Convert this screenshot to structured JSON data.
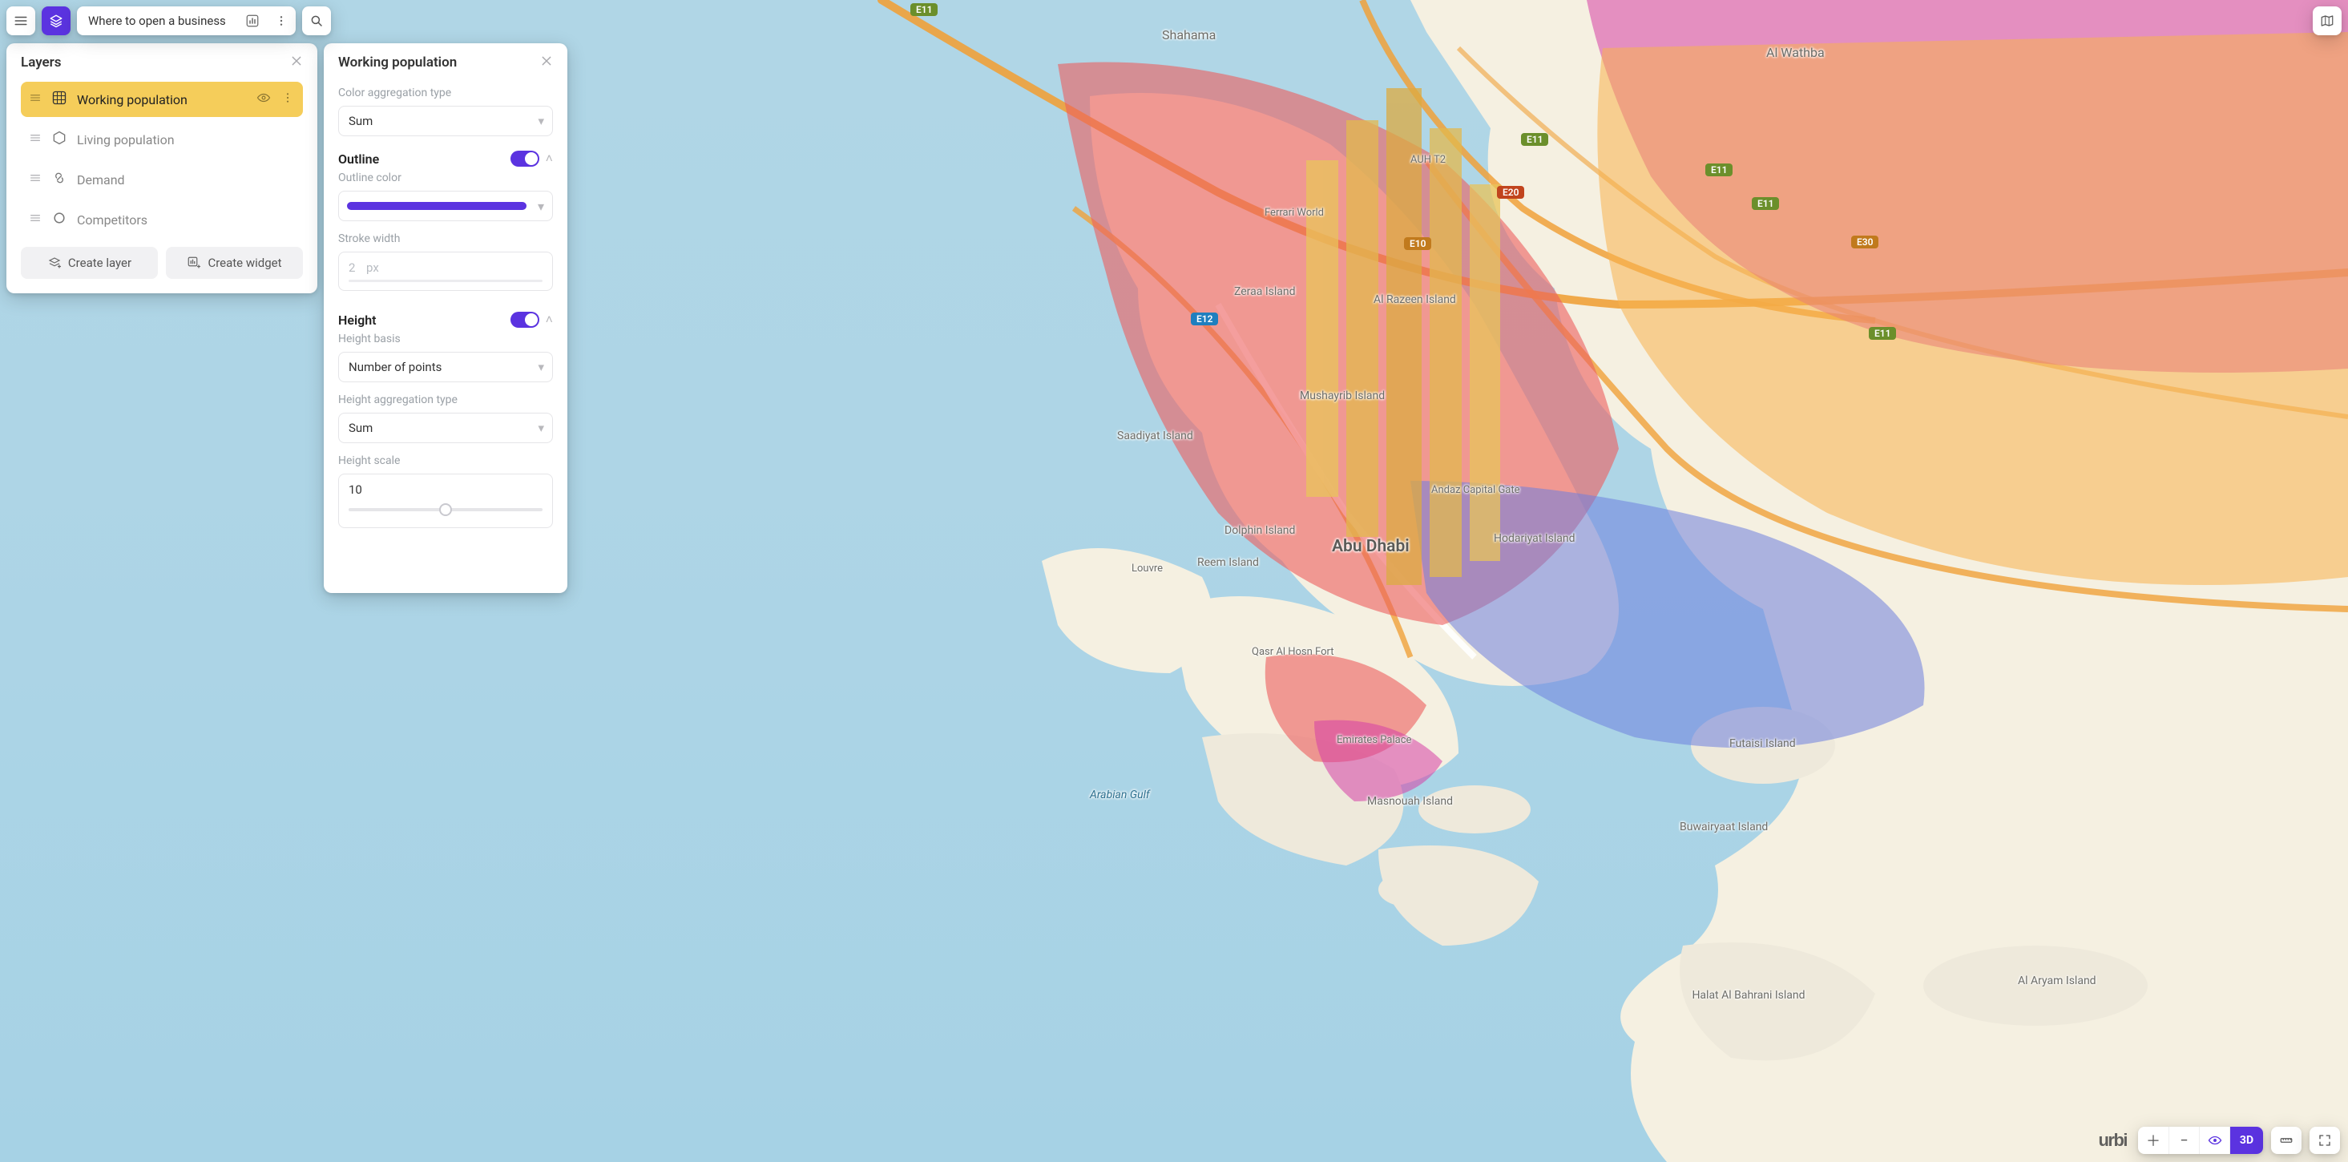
{
  "topbar": {
    "project_title": "Where to open a business"
  },
  "layers_panel": {
    "title": "Layers",
    "items": [
      {
        "label": "Working population",
        "selected": true,
        "icon": "grid-3d"
      },
      {
        "label": "Living population",
        "selected": false,
        "icon": "hexagon"
      },
      {
        "label": "Demand",
        "selected": false,
        "icon": "link"
      },
      {
        "label": "Competitors",
        "selected": false,
        "icon": "circle"
      }
    ],
    "create_layer_label": "Create layer",
    "create_widget_label": "Create widget"
  },
  "settings_panel": {
    "title": "Working population",
    "labels": {
      "color_agg": "Color aggregation type",
      "outline": "Outline",
      "outline_color": "Outline color",
      "stroke_width": "Stroke width",
      "height": "Height",
      "height_basis": "Height basis",
      "height_agg": "Height aggregation type",
      "height_scale": "Height scale"
    },
    "color_agg_value": "Sum",
    "outline_on": true,
    "outline_color": "#5b33e0",
    "stroke_width_value": "2",
    "stroke_width_unit": "px",
    "height_on": true,
    "height_basis_value": "Number of points",
    "height_agg_value": "Sum",
    "height_scale_value": "10",
    "height_scale_pct": 50
  },
  "map": {
    "city": "Abu Dhabi",
    "district_top": "Shahama",
    "district_right": "Al Wathba",
    "water_label": "Arabian Gulf",
    "islands": {
      "zeraa": "Zeraa Island",
      "razeen": "Al Razeen Island",
      "mushayrib": "Mushayrib Island",
      "saadiyat": "Saadiyat Island",
      "dolphin": "Dolphin Island",
      "reem": "Reem Island",
      "hodariyat": "Hodariyat Island",
      "masnouah": "Masnouah Island",
      "futaisi": "Futaisi Island",
      "buwairyaat": "Buwairyaat Island",
      "halat": "Halat Al Bahrani Island",
      "aryam": "Al Aryam Island"
    },
    "pois": {
      "ferrari": "Ferrari World",
      "auh": "AUH T2",
      "andaz": "Andaz Capital Gate",
      "louvre": "Louvre",
      "qasr": "Qasr Al Hosn Fort",
      "emirates": "Emirates Palace"
    },
    "roads": {
      "e11": "E11",
      "e10": "E10",
      "e12": "E12",
      "e20": "E20",
      "e30": "E30"
    },
    "logo": "urbi",
    "btn_3d": "3D"
  }
}
